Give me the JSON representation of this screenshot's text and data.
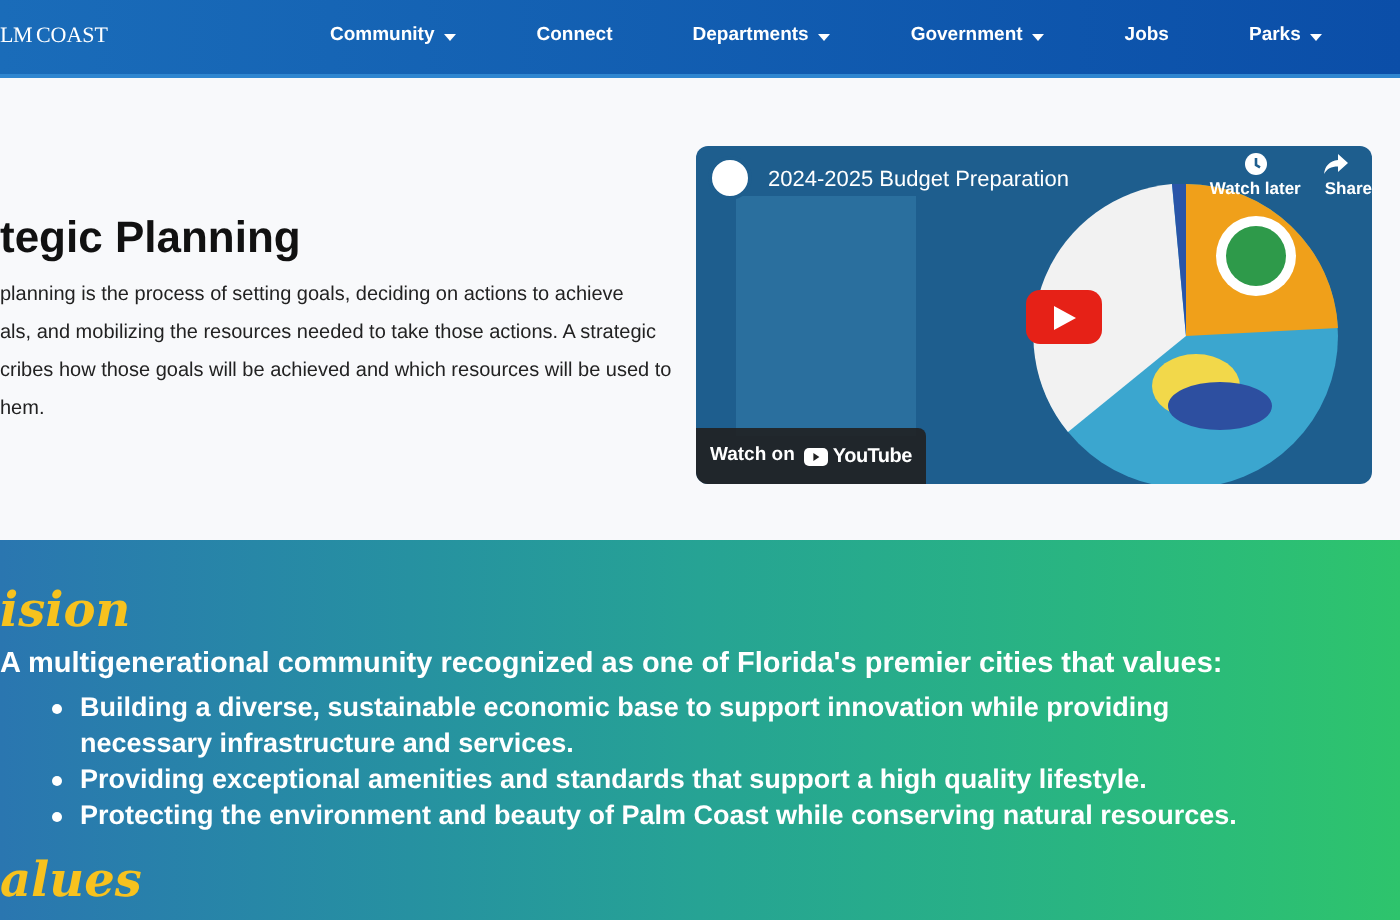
{
  "header": {
    "logo_left": "LM",
    "logo_right": "COAST",
    "nav": [
      {
        "label": "Community",
        "has_dropdown": true
      },
      {
        "label": "Connect",
        "has_dropdown": false
      },
      {
        "label": "Departments",
        "has_dropdown": true
      },
      {
        "label": "Government",
        "has_dropdown": true
      },
      {
        "label": "Jobs",
        "has_dropdown": false
      },
      {
        "label": "Parks",
        "has_dropdown": true
      }
    ]
  },
  "intro": {
    "heading": "tegic Planning",
    "paragraph_lines": [
      "planning is the process of setting goals, deciding on actions to achieve",
      "als, and mobilizing the resources needed to take those actions. A strategic",
      "cribes how those goals will be achieved and which resources will be used to",
      "hem."
    ]
  },
  "video": {
    "kind": "picture",
    "title": "2024-2025 Budget Preparation",
    "watch_later": "Watch later",
    "share": "Share",
    "watch_on": "Watch on",
    "brand": "YouTube"
  },
  "vision": {
    "heading": "ision",
    "statement": "A multigenerational community recognized as one of Florida's premier cities that values:",
    "bullets": [
      "Building a diverse, sustainable economic base to support innovation while providing necessary infrastructure and services.",
      "Providing exceptional amenities and standards that support a high quality lifestyle.",
      "Protecting the environment and beauty of Palm Coast while conserving natural resources."
    ]
  },
  "values": {
    "heading": "alues"
  }
}
